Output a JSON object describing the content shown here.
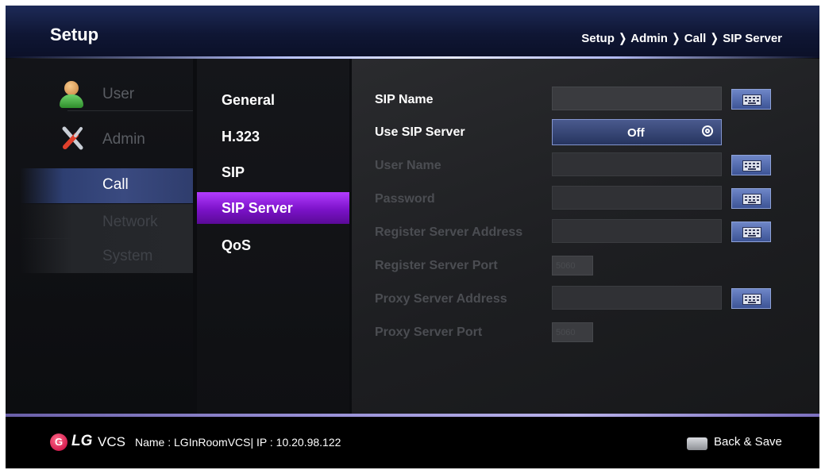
{
  "header": {
    "title": "Setup",
    "breadcrumb": "Setup ❭ Admin ❭ Call ❭ SIP Server"
  },
  "menu_level1": {
    "items": [
      {
        "label": "User",
        "icon": "user-icon",
        "state": "inactive"
      },
      {
        "label": "Admin",
        "icon": "tools-icon",
        "state": "inactive"
      },
      {
        "label": "Call",
        "state": "selected"
      },
      {
        "label": "Network",
        "state": "dimmed"
      },
      {
        "label": "System",
        "state": "dimmed"
      }
    ]
  },
  "menu_level2": {
    "items": [
      {
        "label": "General"
      },
      {
        "label": "H.323"
      },
      {
        "label": "SIP"
      },
      {
        "label": "SIP Server",
        "state": "selected"
      },
      {
        "label": "QoS"
      }
    ]
  },
  "settings": {
    "sip_name": {
      "label": "SIP Name",
      "value": ""
    },
    "use_sip_server": {
      "label": "Use SIP Server",
      "value": "Off"
    },
    "user_name": {
      "label": "User Name",
      "value": ""
    },
    "password": {
      "label": "Password",
      "value": ""
    },
    "register_server_address": {
      "label": "Register Server Address",
      "value": ""
    },
    "register_server_port": {
      "label": "Register Server Port",
      "value": "5060"
    },
    "proxy_server_address": {
      "label": "Proxy Server Address",
      "value": ""
    },
    "proxy_server_port": {
      "label": "Proxy Server Port",
      "value": "5060"
    }
  },
  "footer": {
    "brand": "LG",
    "product": "VCS",
    "status": "Name : LGInRoomVCS| IP : 10.20.98.122",
    "back_label": "Back & Save"
  },
  "colors": {
    "selected_menu": "#8a1fd4",
    "selected_category": "#33467a",
    "header_bg": "#16204a"
  }
}
